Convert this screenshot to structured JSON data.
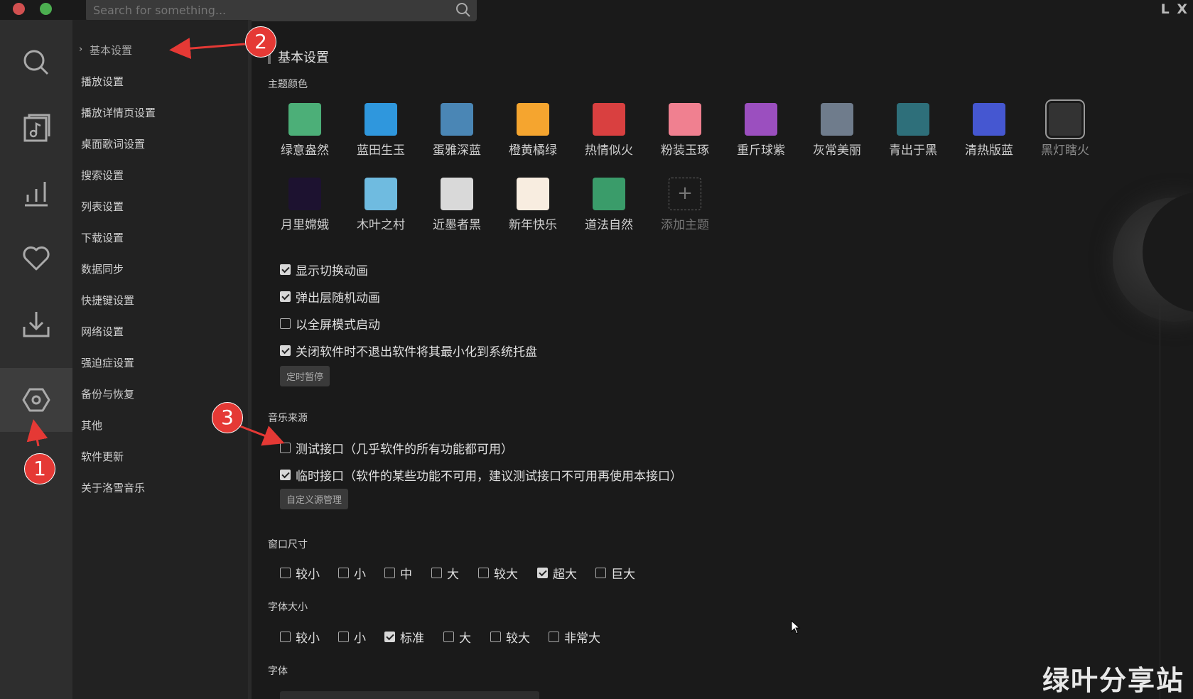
{
  "window": {
    "search_placeholder": "Search for something...",
    "controls": "L X",
    "traffic_colors": [
      "#d25050",
      "#4caf50"
    ]
  },
  "rail": {
    "items": [
      {
        "icon": "search-icon"
      },
      {
        "icon": "music-note-icon"
      },
      {
        "icon": "chart-bars-icon"
      },
      {
        "icon": "heart-icon"
      },
      {
        "icon": "download-icon"
      },
      {
        "icon": "settings-hexagon-icon",
        "active": true
      }
    ]
  },
  "menu": {
    "items": [
      {
        "label": "基本设置"
      },
      {
        "label": "播放设置"
      },
      {
        "label": "播放详情页设置"
      },
      {
        "label": "桌面歌词设置"
      },
      {
        "label": "搜索设置"
      },
      {
        "label": "列表设置"
      },
      {
        "label": "下载设置"
      },
      {
        "label": "数据同步"
      },
      {
        "label": "快捷键设置"
      },
      {
        "label": "网络设置"
      },
      {
        "label": "强迫症设置"
      },
      {
        "label": "备份与恢复"
      },
      {
        "label": "其他"
      },
      {
        "label": "软件更新"
      },
      {
        "label": "关于洛雪音乐"
      }
    ]
  },
  "main": {
    "heading": "基本设置",
    "theme_section": "主题颜色",
    "themes_row1": [
      {
        "label": "绿意盎然",
        "color": "#4caf78"
      },
      {
        "label": "蓝田生玉",
        "color": "#2f97dd"
      },
      {
        "label": "蛋雅深蓝",
        "color": "#4a86b5"
      },
      {
        "label": "橙黄橘绿",
        "color": "#f5a52f"
      },
      {
        "label": "热情似火",
        "color": "#d94040"
      },
      {
        "label": "粉装玉琢",
        "color": "#f08090"
      },
      {
        "label": "重斤球紫",
        "color": "#9b4fbf"
      },
      {
        "label": "灰常美丽",
        "color": "#6f7c8c"
      },
      {
        "label": "青出于黑",
        "color": "#2e6f7a"
      },
      {
        "label": "清热版蓝",
        "color": "#4557d1"
      },
      {
        "label": "黑灯瞎火",
        "color": "#333333"
      }
    ],
    "themes_row2": [
      {
        "label": "月里嫦娥",
        "color": "#1d1230"
      },
      {
        "label": "木叶之村",
        "color": "#6fbbe0"
      },
      {
        "label": "近墨者黑",
        "color": "#d9d9d9"
      },
      {
        "label": "新年快乐",
        "color": "#f8ede0"
      },
      {
        "label": "道法自然",
        "color": "#3a9c6a"
      }
    ],
    "add_theme": "添加主题",
    "checks_basic": [
      {
        "label": "显示切换动画",
        "checked": true
      },
      {
        "label": "弹出层随机动画",
        "checked": true
      },
      {
        "label": "以全屏模式启动",
        "checked": false
      },
      {
        "label": "关闭软件时不退出软件将其最小化到系统托盘",
        "checked": true
      }
    ],
    "timer_button": "定时暂停",
    "source_section": "音乐来源",
    "sources": [
      {
        "label": "测试接口（几乎软件的所有功能都可用）",
        "checked": false
      },
      {
        "label": "临时接口（软件的某些功能不可用，建议测试接口不可用再使用本接口）",
        "checked": true
      }
    ],
    "custom_source_button": "自定义源管理",
    "window_size_section": "窗口尺寸",
    "window_sizes": [
      {
        "label": "较小",
        "checked": false
      },
      {
        "label": "小",
        "checked": false
      },
      {
        "label": "中",
        "checked": false
      },
      {
        "label": "大",
        "checked": false
      },
      {
        "label": "较大",
        "checked": false
      },
      {
        "label": "超大",
        "checked": true
      },
      {
        "label": "巨大",
        "checked": false
      }
    ],
    "font_size_section": "字体大小",
    "font_sizes": [
      {
        "label": "较小",
        "checked": false
      },
      {
        "label": "小",
        "checked": false
      },
      {
        "label": "标准",
        "checked": true
      },
      {
        "label": "大",
        "checked": false
      },
      {
        "label": "较大",
        "checked": false
      },
      {
        "label": "非常大",
        "checked": false
      }
    ],
    "font_section": "字体"
  },
  "annotations": {
    "badge1": "1",
    "badge2": "2",
    "badge3": "3"
  },
  "watermark": "绿叶分享站"
}
